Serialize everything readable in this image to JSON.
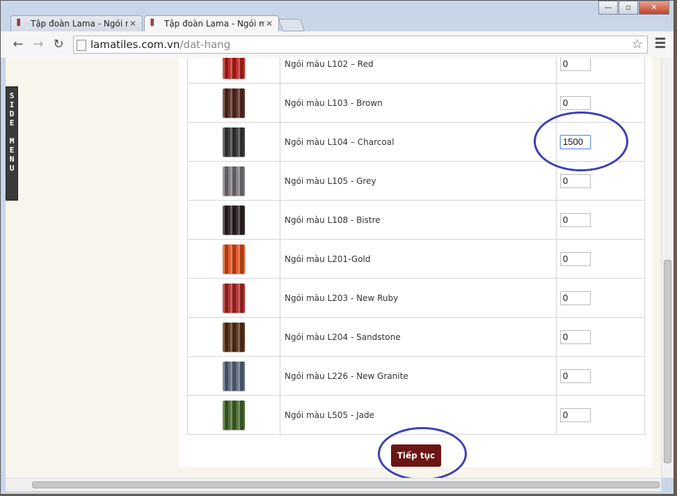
{
  "browser": {
    "tabs": [
      {
        "title": "Tập đoàn Lama - Ngói mà",
        "active": false
      },
      {
        "title": "Tập đoàn Lama - Ngói mà",
        "active": true
      }
    ],
    "url_host": "lamatiles.com.vn",
    "url_path": "/dat-hang"
  },
  "sidemenu": {
    "letters": [
      "S",
      "I",
      "D",
      "E",
      "",
      "M",
      "E",
      "N",
      "U"
    ]
  },
  "products": [
    {
      "name": "Ngói màu L102 – Red",
      "qty": "0",
      "color": "#c2221c"
    },
    {
      "name": "Ngói màu L103 - Brown",
      "qty": "0",
      "color": "#5a2a22"
    },
    {
      "name": "Ngói màu L104 – Charcoal",
      "qty": "1500",
      "color": "#3a3a3a"
    },
    {
      "name": "Ngói màu L105 - Grey",
      "qty": "0",
      "color": "#7d7a80"
    },
    {
      "name": "Ngói màu L108 - Bistre",
      "qty": "0",
      "color": "#2f2424"
    },
    {
      "name": "Ngói màu L201-Gold",
      "qty": "0",
      "color": "#e4501a"
    },
    {
      "name": "Ngói màu L203 - New Ruby",
      "qty": "0",
      "color": "#b52a2a"
    },
    {
      "name": "Ngói màu L204 - Sandstone",
      "qty": "0",
      "color": "#5a3318"
    },
    {
      "name": "Ngói màu L226 - New Granite",
      "qty": "0",
      "color": "#5c6b80"
    },
    {
      "name": "Ngói màu L505 - Jade",
      "qty": "0",
      "color": "#466b2c"
    }
  ],
  "continue_label": "Tiếp tục",
  "annotation_color": "#3c3fb5"
}
